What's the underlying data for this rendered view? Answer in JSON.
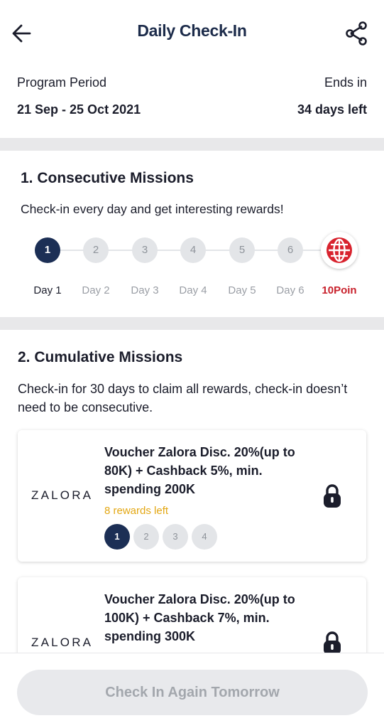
{
  "header": {
    "title": "Daily Check-In",
    "back_icon": "arrow-left-icon",
    "share_icon": "share-icon"
  },
  "program": {
    "period_label": "Program Period",
    "period_value": "21 Sep - 25 Oct 2021",
    "ends_label": "Ends in",
    "ends_value": "34 days left"
  },
  "consecutive": {
    "title": "1. Consecutive Missions",
    "description": "Check-in every day and get interesting rewards!",
    "days": [
      {
        "number": "1",
        "label": "Day 1",
        "state": "checked"
      },
      {
        "number": "2",
        "label": "Day 2",
        "state": "pending"
      },
      {
        "number": "3",
        "label": "Day 3",
        "state": "pending"
      },
      {
        "number": "4",
        "label": "Day 4",
        "state": "pending"
      },
      {
        "number": "5",
        "label": "Day 5",
        "state": "pending"
      },
      {
        "number": "6",
        "label": "Day 6",
        "state": "pending"
      }
    ],
    "reward": {
      "label": "10Poin",
      "icon": "globe-reward-icon"
    }
  },
  "cumulative": {
    "title": "2. Cumulative Missions",
    "description": "Check-in for 30 days to claim all rewards, check-in doesn’t need to be consecutive.",
    "cards": [
      {
        "brand": "ZALORA",
        "title": "Voucher Zalora Disc. 20%(up to 80K) + Cashback 5%, min. spending 200K",
        "rewards_left": "8 rewards left",
        "stamps": [
          "1",
          "2",
          "3",
          "4"
        ],
        "stamps_completed": 1,
        "lock_icon": "lock-icon"
      },
      {
        "brand": "ZALORA",
        "title": "Voucher Zalora Disc. 20%(up to 100K) + Cashback 7%, min. spending 300K",
        "lock_icon": "lock-icon"
      }
    ]
  },
  "footer": {
    "button_label": "Check In Again Tomorrow",
    "button_state": "disabled"
  },
  "colors": {
    "navy": "#1c2f55",
    "reward_red": "#c8202b",
    "rewards_left": "#e3a713",
    "inactive_dot": "#e3e5e8"
  }
}
